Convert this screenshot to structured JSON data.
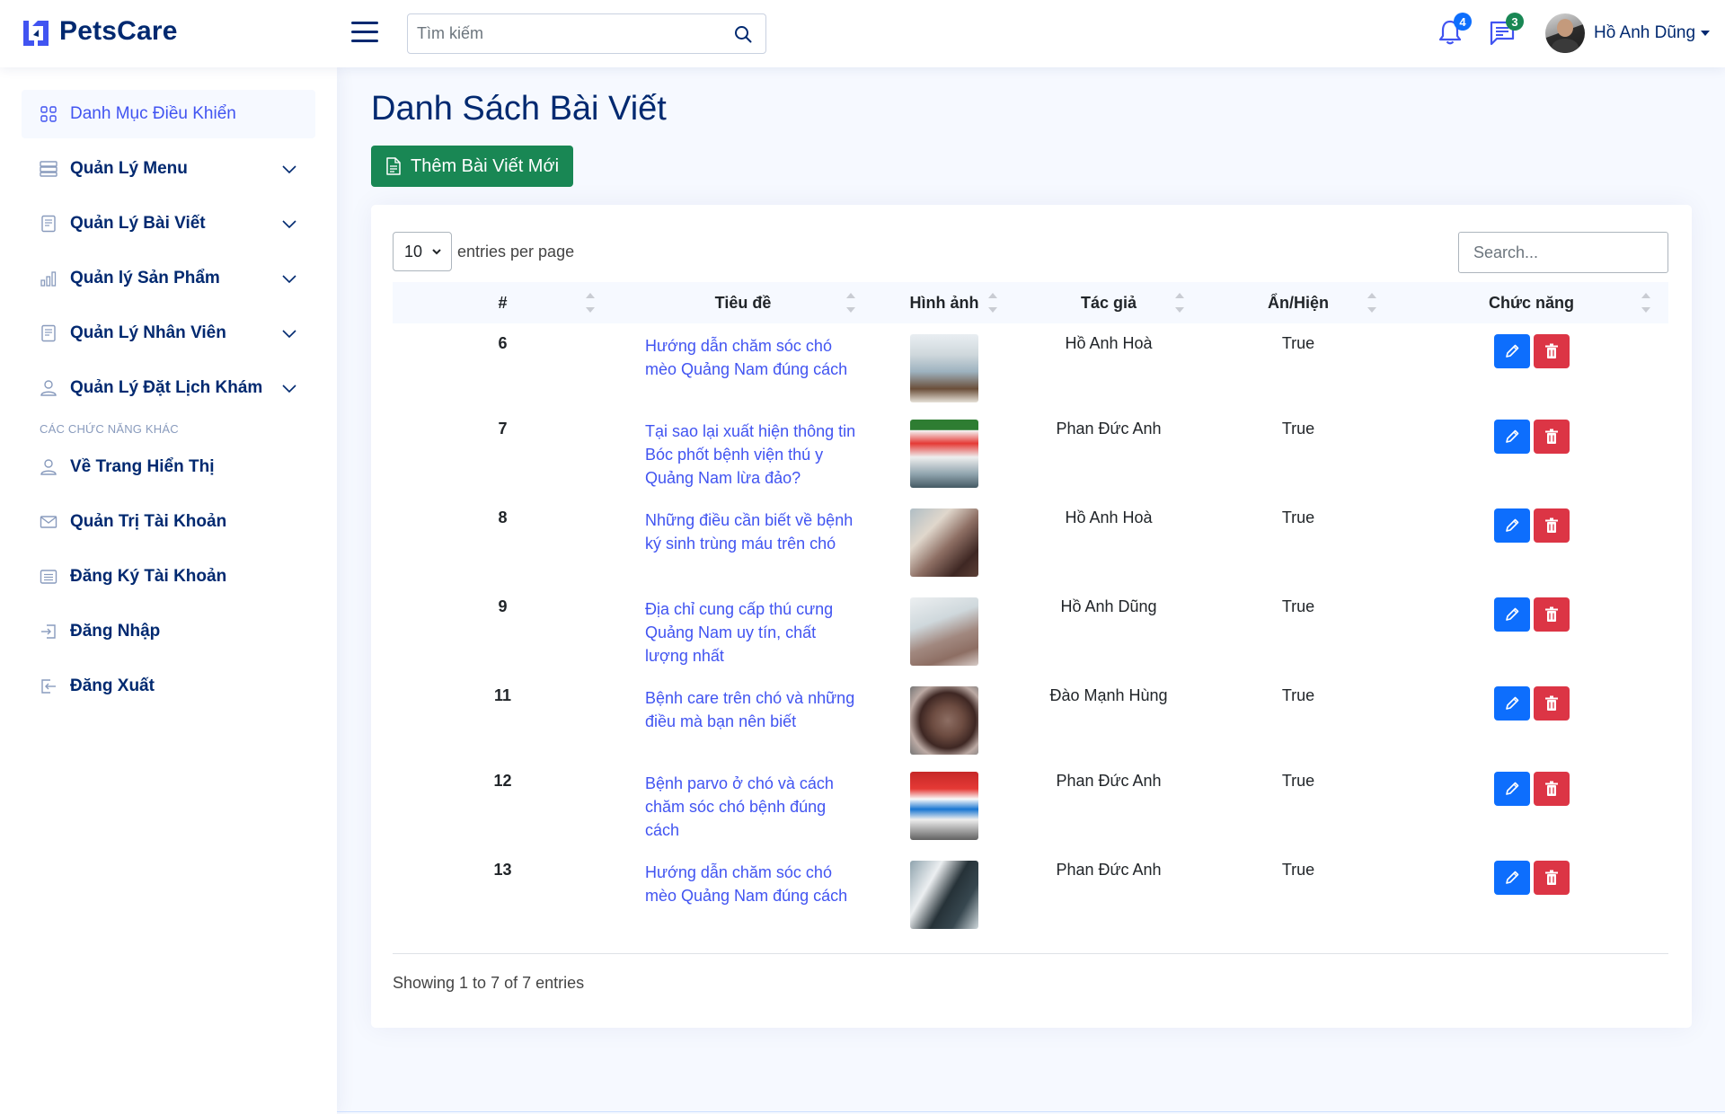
{
  "brand": {
    "name": "PetsCare"
  },
  "header": {
    "search_placeholder": "Tìm kiếm",
    "notifications_count": "4",
    "messages_count": "3",
    "user_name": "Hồ Anh Dũng"
  },
  "sidebar": {
    "items": [
      {
        "label": "Danh Mục Điều Khiển",
        "icon": "grid-icon"
      },
      {
        "label": "Quản Lý Menu",
        "icon": "menu-icon"
      },
      {
        "label": "Quản Lý Bài Viết",
        "icon": "journal-icon"
      },
      {
        "label": "Quản lý Sản Phẩm",
        "icon": "bar-chart-icon"
      },
      {
        "label": "Quản Lý Nhân Viên",
        "icon": "journal-icon"
      },
      {
        "label": "Quản Lý Đặt Lịch Khám",
        "icon": "person-icon"
      }
    ],
    "heading": "CÁC CHỨC NĂNG KHÁC",
    "other_items": [
      {
        "label": "Về Trang Hiển Thị",
        "icon": "person-icon"
      },
      {
        "label": "Quản Trị Tài Khoản",
        "icon": "envelope-icon"
      },
      {
        "label": "Đăng Ký Tài Khoản",
        "icon": "card-list-icon"
      },
      {
        "label": "Đăng Nhập",
        "icon": "box-arrow-in-icon"
      },
      {
        "label": "Đăng Xuất",
        "icon": "box-arrow-out-icon"
      }
    ]
  },
  "main": {
    "title": "Danh Sách Bài Viết",
    "add_button": "Thêm Bài Viết Mới",
    "per_page_value": "10",
    "per_page_label": "entries per page",
    "search_placeholder": "Search...",
    "columns": [
      "#",
      "Tiêu đề",
      "Hình ảnh",
      "Tác giả",
      "Ẩn/Hiện",
      "Chức năng"
    ],
    "rows": [
      {
        "id": "6",
        "title": "Hướng dẫn chăm sóc chó mèo Quảng Nam đúng cách",
        "author": "Hồ Anh Hoà",
        "visible": "True"
      },
      {
        "id": "7",
        "title": "Tại sao lại xuất hiện thông tin Bóc phốt bệnh viện thú y Quảng Nam lừa đảo?",
        "author": "Phan Đức Anh",
        "visible": "True"
      },
      {
        "id": "8",
        "title": "Những điều cần biết về bệnh ký sinh trùng máu trên chó",
        "author": "Hồ Anh Hoà",
        "visible": "True"
      },
      {
        "id": "9",
        "title": "Địa chỉ cung cấp thú cưng Quảng Nam uy tín, chất lượng nhất",
        "author": "Hồ Anh Dũng",
        "visible": "True"
      },
      {
        "id": "11",
        "title": "Bệnh care trên chó và những điều mà bạn nên biết",
        "author": "Đào Mạnh Hùng",
        "visible": "True"
      },
      {
        "id": "12",
        "title": "Bệnh parvo ở chó và cách chăm sóc chó bệnh đúng cách",
        "author": "Phan Đức Anh",
        "visible": "True"
      },
      {
        "id": "13",
        "title": "Hướng dẫn chăm sóc chó mèo Quảng Nam đúng cách",
        "author": "Phan Đức Anh",
        "visible": "True"
      }
    ],
    "info": "Showing 1 to 7 of 7 entries"
  },
  "colors": {
    "primary": "#4154f1",
    "navy": "#012970",
    "success": "#198754",
    "edit": "#0d6efd",
    "delete": "#dc3545",
    "badge_notifications": "#0d6efd",
    "badge_messages": "#198754"
  }
}
